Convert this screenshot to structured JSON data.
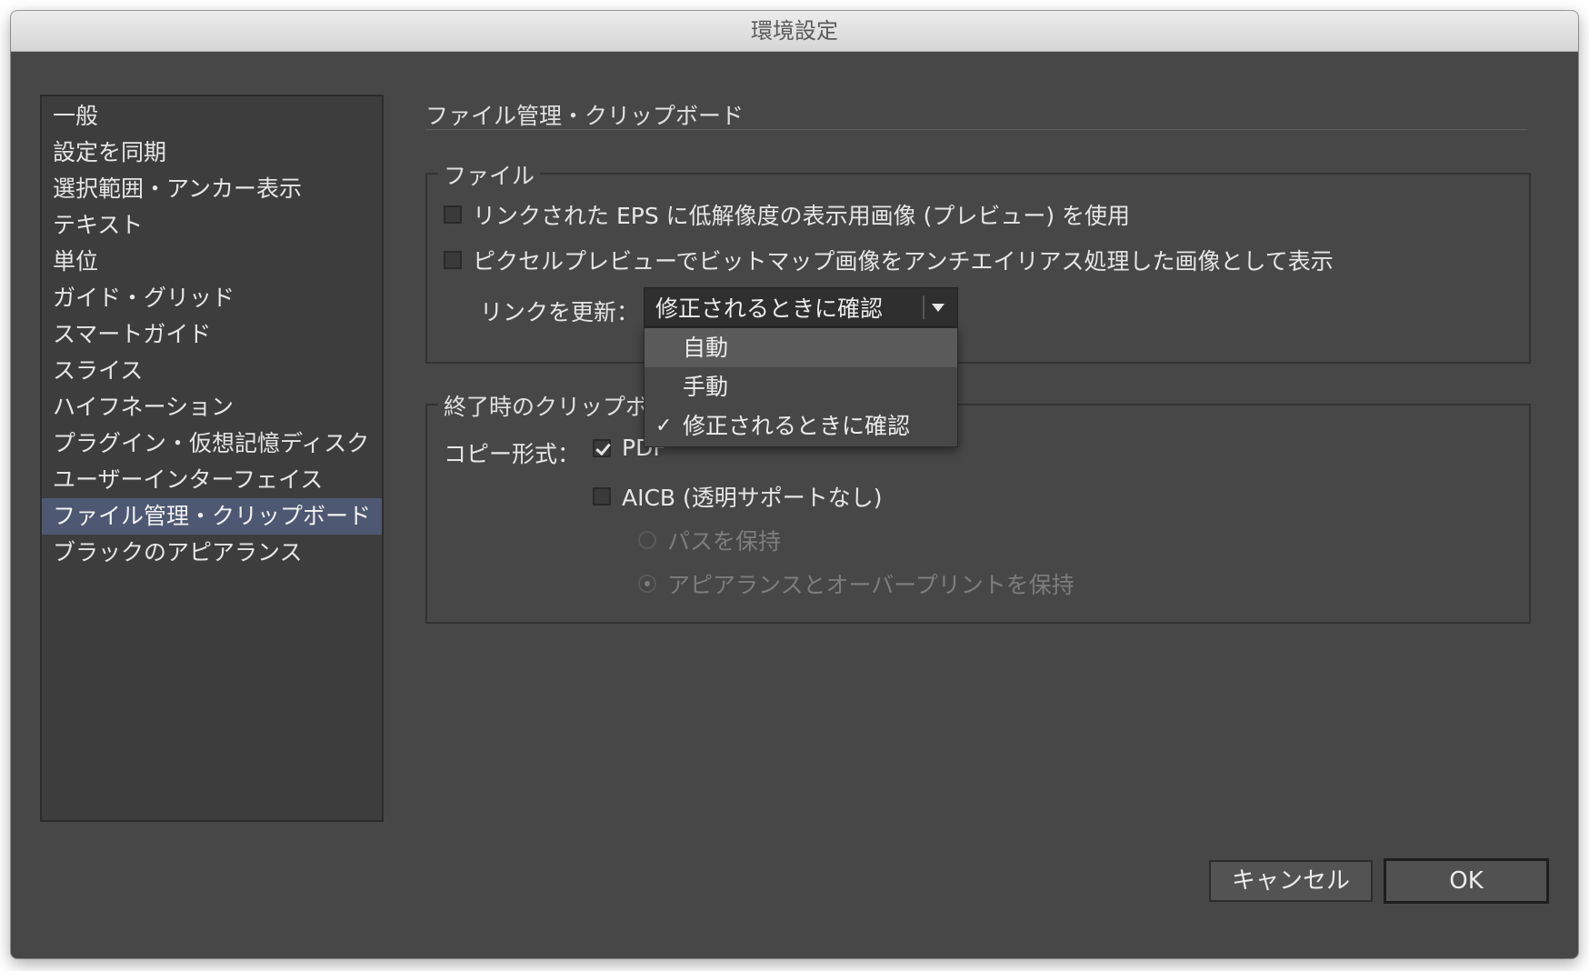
{
  "window": {
    "title": "環境設定"
  },
  "sidebar": {
    "items": [
      {
        "label": "一般"
      },
      {
        "label": "設定を同期"
      },
      {
        "label": "選択範囲・アンカー表示"
      },
      {
        "label": "テキスト"
      },
      {
        "label": "単位"
      },
      {
        "label": "ガイド・グリッド"
      },
      {
        "label": "スマートガイド"
      },
      {
        "label": "スライス"
      },
      {
        "label": "ハイフネーション"
      },
      {
        "label": "プラグイン・仮想記憶ディスク"
      },
      {
        "label": "ユーザーインターフェイス"
      },
      {
        "label": "ファイル管理・クリップボード"
      },
      {
        "label": "ブラックのアピアランス"
      }
    ],
    "selected_index": 11
  },
  "main": {
    "title": "ファイル管理・クリップボード",
    "file_group": {
      "label": "ファイル",
      "low_res_eps_preview": {
        "label": "リンクされた EPS に低解像度の表示用画像 (プレビュー) を使用",
        "checked": false
      },
      "antialias_pixel_preview": {
        "label": "ピクセルプレビューでビットマップ画像をアンチエイリアス処理した画像として表示",
        "checked": false
      },
      "update_links": {
        "label": "リンクを更新：",
        "value": "修正されるときに確認",
        "options": [
          {
            "label": "自動",
            "highlighted": true,
            "checked": false
          },
          {
            "label": "手動",
            "highlighted": false,
            "checked": false
          },
          {
            "label": "修正されるときに確認",
            "highlighted": false,
            "checked": true
          }
        ],
        "check_glyph": "✓"
      }
    },
    "clipboard_group": {
      "label": "終了時のクリップボード",
      "copy_format_label": "コピー形式：",
      "pdf": {
        "label": "PDF",
        "checked": true
      },
      "aicb": {
        "label": "AICB (透明サポートなし)",
        "checked": false
      },
      "preserve_paths": {
        "label": "パスを保持",
        "selected": false,
        "enabled": false
      },
      "preserve_appearance": {
        "label": "アピアランスとオーバープリントを保持",
        "selected": true,
        "enabled": false
      }
    }
  },
  "buttons": {
    "cancel": "キャンセル",
    "ok": "OK"
  },
  "colors": {
    "window_bg": "#474747",
    "selection": "#4e5872"
  }
}
